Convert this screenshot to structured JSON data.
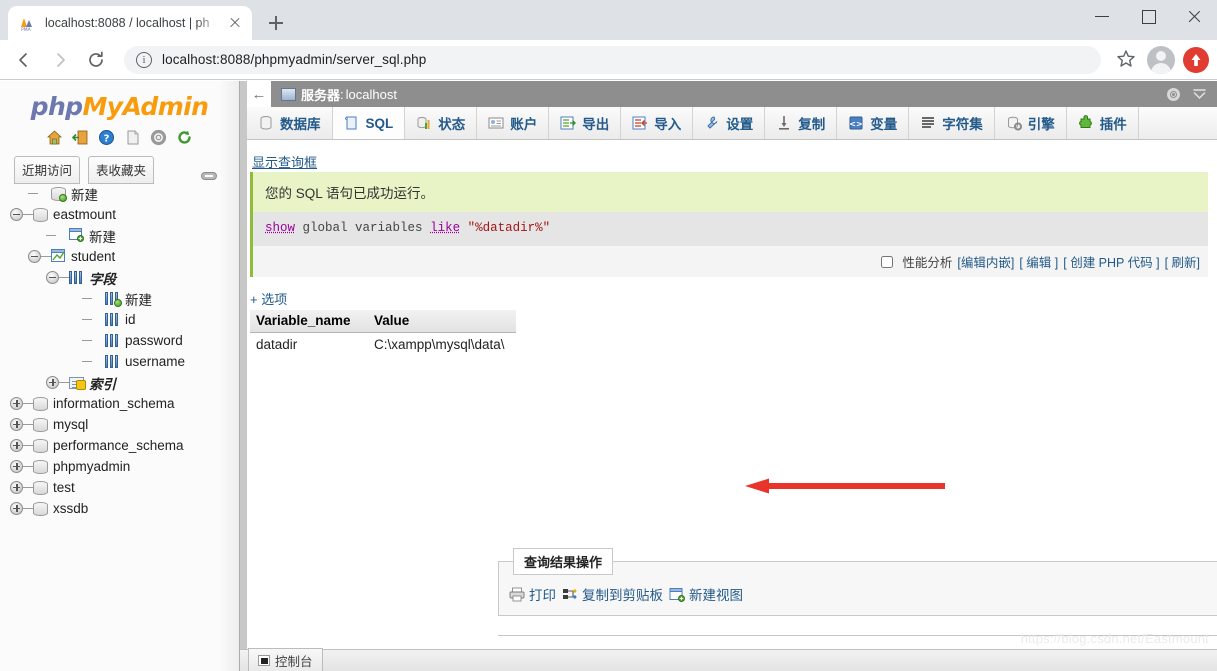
{
  "browser": {
    "tab_title": "localhost:8088 / localhost | ph",
    "tab_favicon": "phpmyadmin-favicon",
    "new_tab_label": "+",
    "url": "localhost:8088/phpmyadmin/server_sql.php",
    "back_icon": "back-arrow-icon",
    "forward_icon": "forward-arrow-icon",
    "reload_icon": "reload-icon",
    "info_icon": "info-circle-icon",
    "star_icon": "bookmark-star-icon",
    "avatar_icon": "profile-avatar-icon",
    "update_icon": "update-arrow-icon",
    "minimize_icon": "minimize-icon",
    "maximize_icon": "maximize-icon",
    "close_icon": "close-icon"
  },
  "sidebar": {
    "logo": {
      "php": "php",
      "my": "My",
      "admin": "Admin"
    },
    "logo_icons": [
      "home-icon",
      "logout-icon",
      "help-icon",
      "docs-icon",
      "settings-icon",
      "reload-icon"
    ],
    "tabs": [
      {
        "label": "近期访问"
      },
      {
        "label": "表收藏夹"
      }
    ],
    "chain_icon": "chain-link-icon",
    "tree": [
      {
        "label": "新建",
        "kind": "new-db",
        "indent": 1,
        "toggle": "none"
      },
      {
        "label": "eastmount",
        "kind": "db",
        "indent": 0,
        "toggle": "minus"
      },
      {
        "label": "新建",
        "kind": "new-table",
        "indent": 2,
        "toggle": "none"
      },
      {
        "label": "student",
        "kind": "table",
        "indent": 1,
        "toggle": "minus"
      },
      {
        "label": "字段",
        "kind": "columns",
        "indent": 2,
        "toggle": "minus",
        "italic": true
      },
      {
        "label": "新建",
        "kind": "new-column",
        "indent": 4,
        "toggle": "none"
      },
      {
        "label": "id",
        "kind": "column",
        "indent": 4,
        "toggle": "none"
      },
      {
        "label": "password",
        "kind": "column",
        "indent": 4,
        "toggle": "none"
      },
      {
        "label": "username",
        "kind": "column",
        "indent": 4,
        "toggle": "none"
      },
      {
        "label": "索引",
        "kind": "index",
        "indent": 2,
        "toggle": "plus",
        "italic": true
      },
      {
        "label": "information_schema",
        "kind": "db",
        "indent": 0,
        "toggle": "plus"
      },
      {
        "label": "mysql",
        "kind": "db",
        "indent": 0,
        "toggle": "plus"
      },
      {
        "label": "performance_schema",
        "kind": "db",
        "indent": 0,
        "toggle": "plus"
      },
      {
        "label": "phpmyadmin",
        "kind": "db",
        "indent": 0,
        "toggle": "plus"
      },
      {
        "label": "test",
        "kind": "db",
        "indent": 0,
        "toggle": "plus"
      },
      {
        "label": "xssdb",
        "kind": "db",
        "indent": 0,
        "toggle": "plus"
      }
    ]
  },
  "server_bar": {
    "back_label": "←",
    "server_icon": "server-monitor-icon",
    "label": "服务器",
    "separator": ":",
    "host": "localhost",
    "tools": [
      "settings-gear-icon",
      "collapse-icon"
    ]
  },
  "tabs": [
    {
      "label": "数据库",
      "icon": "database-icon",
      "active": false
    },
    {
      "label": "SQL",
      "icon": "sql-document-icon",
      "active": true
    },
    {
      "label": "状态",
      "icon": "status-chart-icon",
      "active": false
    },
    {
      "label": "账户",
      "icon": "accounts-icon",
      "active": false
    },
    {
      "label": "导出",
      "icon": "export-icon",
      "active": false
    },
    {
      "label": "导入",
      "icon": "import-icon",
      "active": false
    },
    {
      "label": "设置",
      "icon": "wrench-settings-icon",
      "active": false
    },
    {
      "label": "复制",
      "icon": "replication-icon",
      "active": false
    },
    {
      "label": "变量",
      "icon": "variables-icon",
      "active": false
    },
    {
      "label": "字符集",
      "icon": "charset-icon",
      "active": false
    },
    {
      "label": "引擎",
      "icon": "engines-icon",
      "active": false
    },
    {
      "label": "插件",
      "icon": "plugins-icon",
      "active": false
    }
  ],
  "main": {
    "show_query_link": "显示查询框",
    "success_message": "您的 SQL 语句已成功运行。",
    "sql": {
      "kw1": "show",
      "t1": "global variables",
      "kw2": "like",
      "str": "\"%datadir%\""
    },
    "profiling": {
      "checkbox_label": "性能分析",
      "links": [
        "[编辑内嵌]",
        "[ 编辑 ]",
        "[ 创建 PHP 代码 ]",
        "[ 刷新]"
      ]
    },
    "options_link": "+ 选项",
    "table": {
      "headers": [
        "Variable_name",
        "Value"
      ],
      "rows": [
        [
          "datadir",
          "C:\\xampp\\mysql\\data\\"
        ]
      ]
    },
    "annotation": {
      "type": "red-arrow",
      "color": "#e8342a"
    },
    "query_ops": {
      "legend": "查询结果操作",
      "items": [
        {
          "label": "打印",
          "icon": "printer-icon"
        },
        {
          "label": "复制到剪贴板",
          "icon": "clipboard-copy-icon"
        },
        {
          "label": "新建视图",
          "icon": "new-view-icon"
        }
      ]
    },
    "bottom_icon": "window-restore-icon"
  },
  "console": {
    "label": "控制台",
    "icon": "console-icon"
  },
  "watermark": "https://blog.csdn.net/Eastmount"
}
